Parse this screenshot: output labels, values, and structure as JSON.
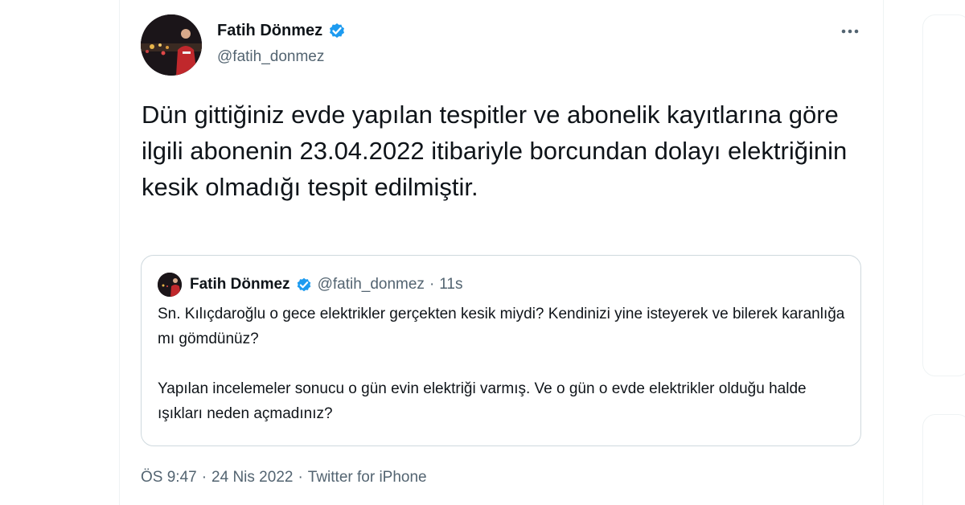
{
  "author": {
    "display_name": "Fatih Dönmez",
    "handle": "@fatih_donmez",
    "verified_icon": "verified-badge-icon",
    "verified_color": "#1d9bf0"
  },
  "tweet": {
    "text": "Dün gittiğiniz evde yapılan tespitler ve abonelik kayıtlarına göre ilgili abonenin 23.04.2022 itibariyle borcundan dolayı elektriğinin kesik olmadığı tespit edilmiştir.",
    "more_icon": "more-horizontal-icon"
  },
  "quoted_tweet": {
    "display_name": "Fatih Dönmez",
    "handle": "@fatih_donmez",
    "separator": "·",
    "time": "11s",
    "paragraph_1": "Sn. Kılıçdaroğlu o gece elektrikler gerçekten kesik miydi? Kendinizi yine isteyerek ve bilerek karanlığa mı gömdünüz?",
    "paragraph_2": "Yapılan incelemeler sonucu o gün evin elektriği varmış. Ve o gün o evde elektrikler olduğu halde ışıkları neden açmadınız?"
  },
  "meta": {
    "time": "ÖS 9:47",
    "separator_1": "·",
    "date": "24 Nis 2022",
    "separator_2": "·",
    "source": "Twitter for iPhone"
  }
}
